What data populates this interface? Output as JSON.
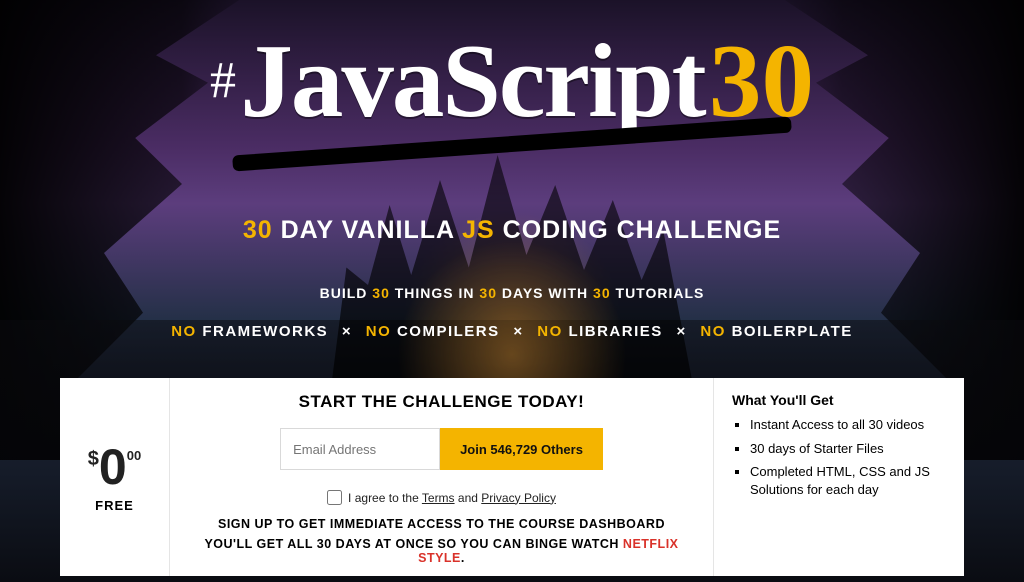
{
  "wordmark": {
    "hash": "#",
    "text": "JavaScript",
    "number": "30"
  },
  "tagline1": {
    "pre": "30",
    "mid1": " DAY VANILLA ",
    "js": "JS",
    "mid2": " CODING CHALLENGE"
  },
  "tagline2": {
    "p1": "BUILD ",
    "n1": "30",
    "p2": " THINGS IN ",
    "n2": "30",
    "p3": " DAYS WITH ",
    "n3": "30",
    "p4": " TUTORIALS"
  },
  "tagline3": {
    "no": "NO",
    "sep": "×",
    "items": [
      "FRAMEWORKS",
      "COMPILERS",
      "LIBRARIES",
      "BOILERPLATE"
    ]
  },
  "price": {
    "currency": "$",
    "amount": "0",
    "cents": "00",
    "label": "FREE"
  },
  "signup": {
    "title": "START THE CHALLENGE TODAY!",
    "email_placeholder": "Email Address",
    "join_label": "Join 546,729 Others",
    "agree_prefix": "I agree to the ",
    "terms": "Terms",
    "and": " and ",
    "privacy": "Privacy Policy",
    "line1": "SIGN UP TO GET IMMEDIATE ACCESS TO THE COURSE DASHBOARD",
    "line2a": "YOU'LL GET ALL 30 DAYS AT ONCE SO YOU CAN BINGE WATCH ",
    "line2b": "NETFLIX STYLE",
    "line2c": "."
  },
  "benefits": {
    "title": "What You'll Get",
    "items": [
      "Instant Access to all 30 videos",
      "30 days of Starter Files",
      "Completed HTML, CSS and JS Solutions for each day"
    ]
  }
}
